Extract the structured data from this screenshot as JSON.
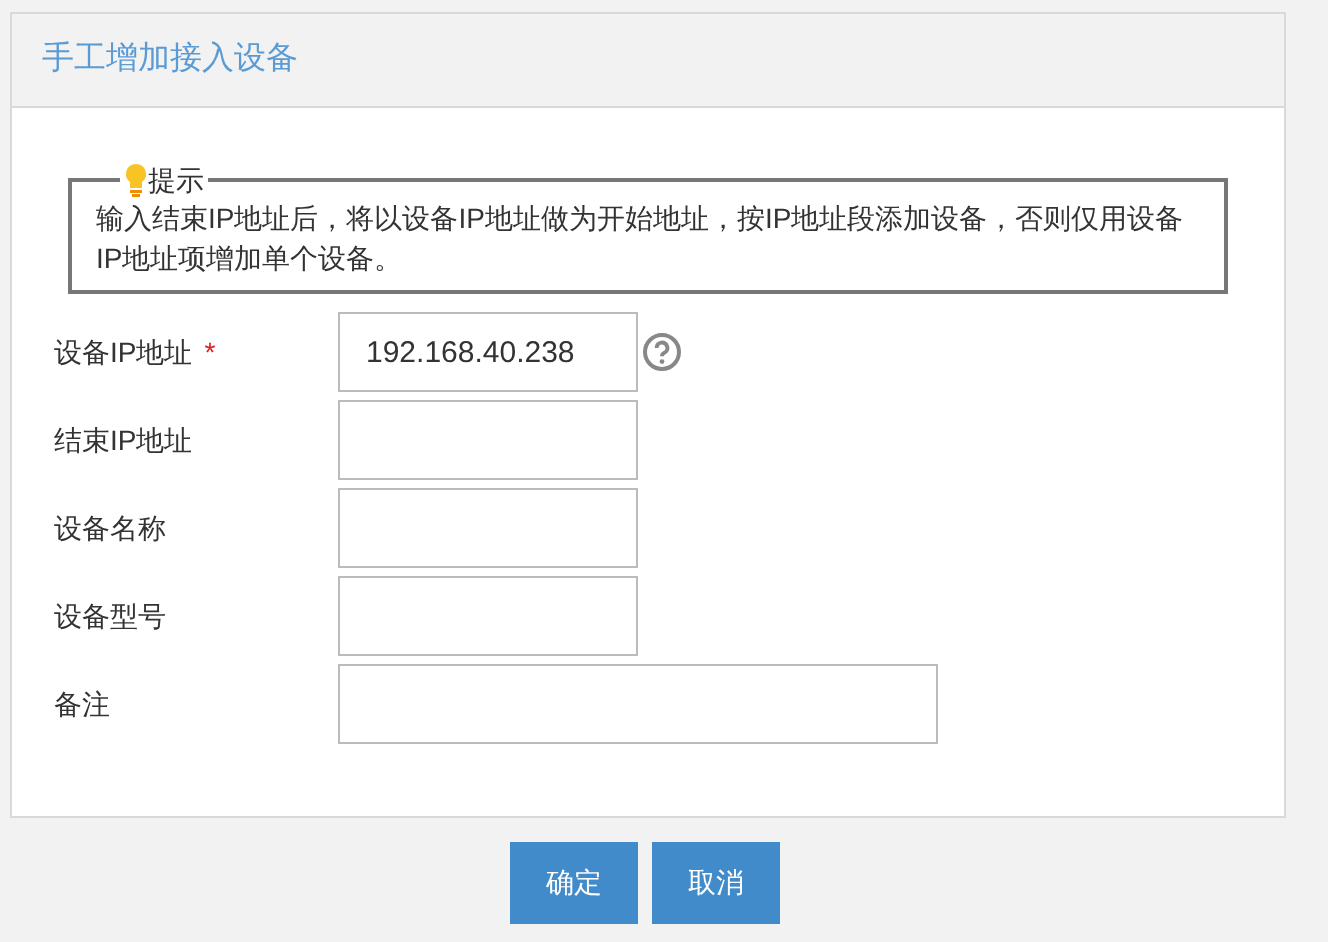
{
  "panel": {
    "title": "手工增加接入设备"
  },
  "tip": {
    "legend": "提示",
    "text": "输入结束IP地址后，将以设备IP地址做为开始地址，按IP地址段添加设备，否则仅用设备IP地址项增加单个设备。"
  },
  "fields": [
    {
      "label": "设备IP地址",
      "required_mark": "*",
      "value": "192.168.40.238",
      "help": true,
      "kind": "short"
    },
    {
      "label": "结束IP地址",
      "kind": "short"
    },
    {
      "label": "设备名称",
      "kind": "short"
    },
    {
      "label": "设备型号",
      "kind": "short"
    },
    {
      "label": "备注",
      "kind": "long"
    }
  ],
  "buttons": [
    "确定",
    "取消"
  ]
}
